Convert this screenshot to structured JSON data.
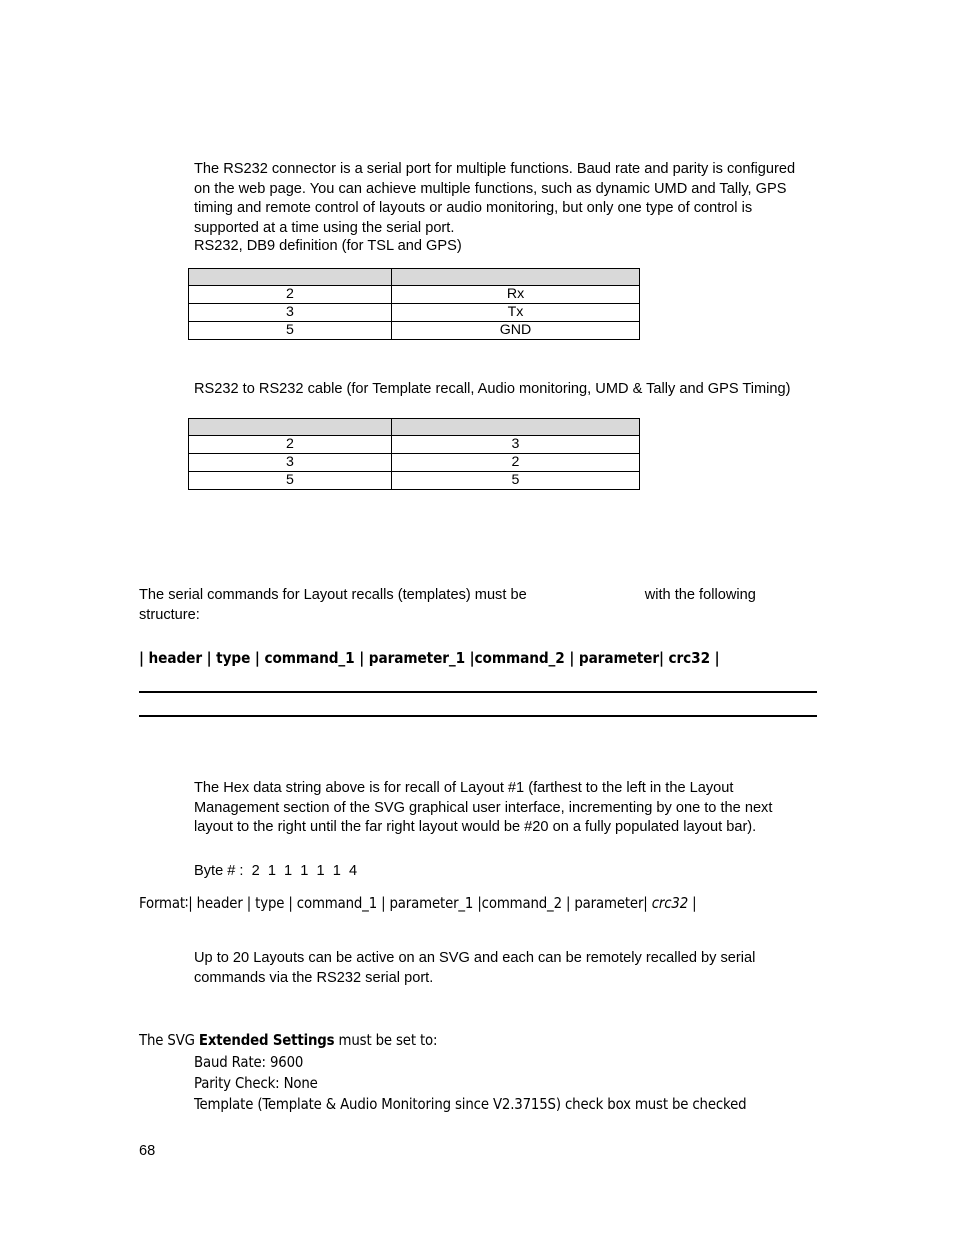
{
  "document": {
    "page_number": "68"
  },
  "intro": {
    "paragraph": "The RS232 connector is a serial port for multiple functions. Baud rate and parity is configured on the web page. You can achieve multiple functions, such as dynamic UMD and Tally, GPS timing and remote control of layouts or audio monitoring, but only one type of control is supported at a time using the serial port.",
    "db9_caption": "RS232, DB9 definition (for TSL and GPS)"
  },
  "db9_table": {
    "headers": [
      "",
      ""
    ],
    "rows": [
      [
        "2",
        "Rx"
      ],
      [
        "3",
        "Tx"
      ],
      [
        "5",
        "GND"
      ]
    ]
  },
  "cable": {
    "caption": "RS232 to RS232 cable (for Template recall, Audio monitoring, UMD & Tally and GPS Timing)"
  },
  "cable_table": {
    "headers": [
      "",
      ""
    ],
    "rows": [
      [
        "2",
        "3"
      ],
      [
        "3",
        "2"
      ],
      [
        "5",
        "5"
      ]
    ]
  },
  "serial_commands": {
    "intro_before_gap": "The serial commands for Layout recalls (templates) must be",
    "intro_after_gap": "with the following structure:",
    "structure_line": "| header | type | command_1 | parameter_1 |command_2 | parameter| crc32 |"
  },
  "hex_section": {
    "paragraph": "The Hex data string above is for recall of Layout #1 (farthest to the left in the Layout Management section of the SVG graphical user interface, incrementing by one to the next layout to the right until the far right layout would be #20 on a fully populated layout bar).",
    "byte_line": "Byte # :  2  1  1  1  1  1  4",
    "format_label": "Format∶",
    "format_body_1": "| header | type | command_1 | parameter_1 |command_2 | parameter| ",
    "format_italic": "crc32",
    "format_body_2": " |"
  },
  "layouts_note": {
    "paragraph": "Up to 20 Layouts can be active on an SVG and each can be remotely recalled by serial commands via the RS232 serial port."
  },
  "extended_settings": {
    "lead_before_bold": "The SVG ",
    "lead_bold": "Extended Settings",
    "lead_after_bold": " must be set to:",
    "lines": [
      "Baud Rate: 9600",
      "Parity Check: None",
      "Template (Template & Audio Monitoring since V2.3715S) check box must be checked"
    ]
  },
  "colors": {
    "table_header_fill": "#d9d9d9",
    "text": "#010101",
    "rule": "#000000"
  }
}
